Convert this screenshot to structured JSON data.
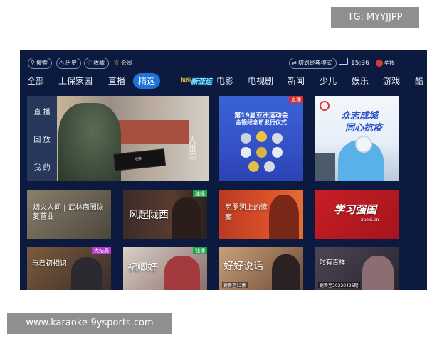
{
  "overlay": {
    "top_badge": "TG: MYYJJPP",
    "bottom_badge": "www.karaoke-9ysports.com"
  },
  "topbar": {
    "search": "搜索",
    "history": "历史",
    "favorites": "收藏",
    "vip": "会员",
    "switch_mode": "切到经典模式",
    "time": "15:36",
    "brand": "华数"
  },
  "nav": {
    "items": [
      {
        "label": "全部"
      },
      {
        "label": "上保家园"
      },
      {
        "label": "直播"
      },
      {
        "label": "精选",
        "active": true
      },
      {
        "label": "电影"
      },
      {
        "label": "电视剧"
      },
      {
        "label": "新闻"
      },
      {
        "label": "少儿"
      },
      {
        "label": "娱乐"
      },
      {
        "label": "游戏"
      },
      {
        "label": "酷"
      }
    ],
    "logo_small": "杭州",
    "logo_main": "新亚运"
  },
  "hero": {
    "side_items": [
      {
        "label": "直 播"
      },
      {
        "label": "回 放"
      },
      {
        "label": "我 的"
      }
    ],
    "calligraphy": "人世间",
    "tablet_text": "观察"
  },
  "tiles": {
    "asiad": {
      "tag": "直播",
      "line1": "第19届亚洲运动会",
      "line2": "金银纪念币发行仪式"
    },
    "covid": {
      "line1": "众志成城",
      "line2": "同心抗疫"
    },
    "row2": [
      {
        "title": "烟火人间 | 武林商圈恢复营业"
      },
      {
        "title": "风起陇西",
        "tag": "独播"
      },
      {
        "title": "尼罗河上的惨案"
      },
      {
        "title": "学习强国",
        "sub": "xuexi.cn"
      }
    ],
    "row3": [
      {
        "title": "与君初相识",
        "tag": "大结局"
      },
      {
        "title": "祝卿好",
        "tag": "独播"
      },
      {
        "title": "好好说话",
        "ep": "更新至12集"
      },
      {
        "title": "时有吉祥",
        "ep": "更新至20220426期"
      }
    ]
  },
  "colors": {
    "tv_bg": "#0b1a3e",
    "active_tab": "#1e73d8",
    "live_red": "#d62e2e",
    "exclusive_green": "#1fa34a",
    "finale_purple": "#b33fd0",
    "badge_gray": "#8f8f8f"
  }
}
